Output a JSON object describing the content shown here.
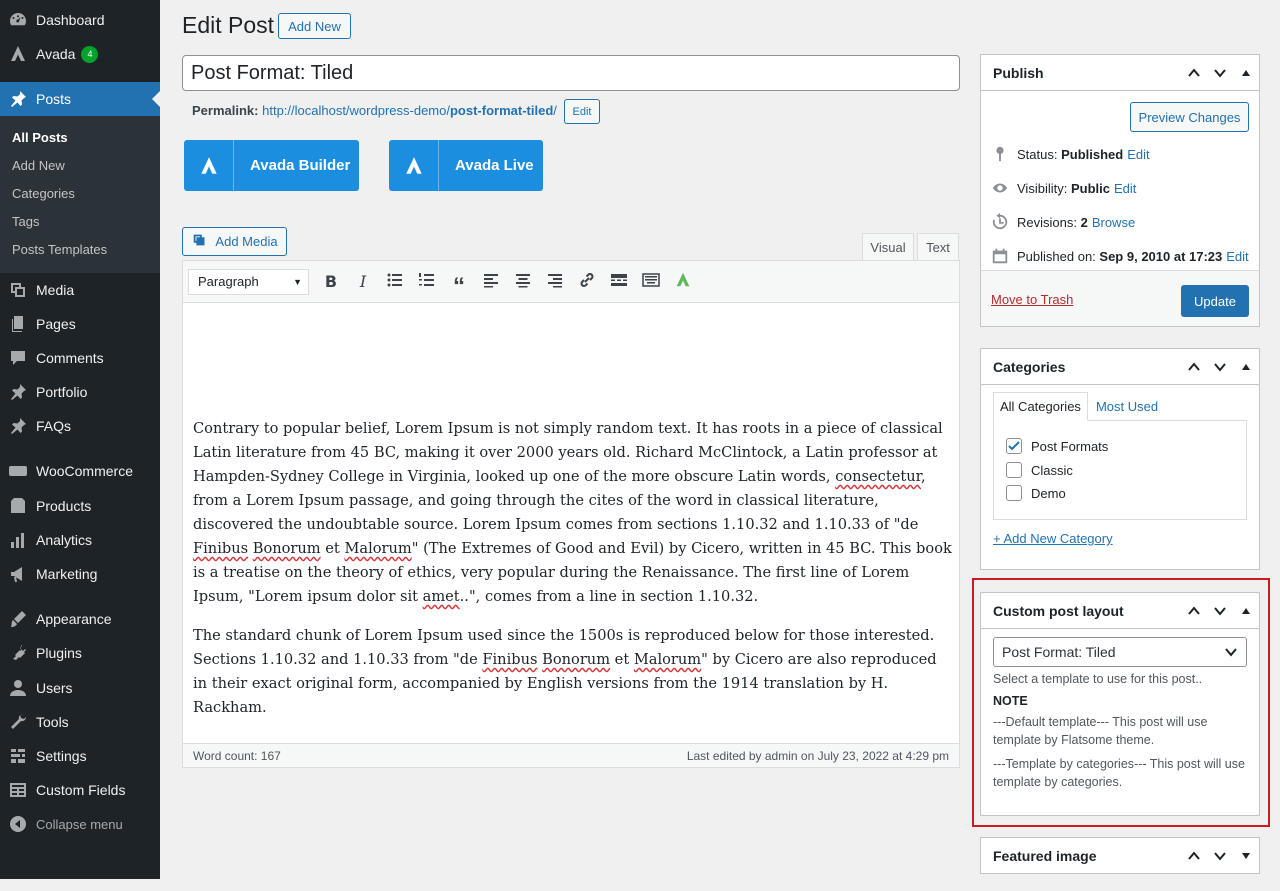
{
  "sidebar": {
    "items": [
      {
        "label": "Dashboard",
        "icon": "dashboard-icon"
      },
      {
        "label": "Avada",
        "icon": "avada-icon",
        "badge": "4"
      },
      {
        "label": "Posts",
        "icon": "pin-icon"
      },
      {
        "label": "Media",
        "icon": "media-icon"
      },
      {
        "label": "Pages",
        "icon": "pages-icon"
      },
      {
        "label": "Comments",
        "icon": "comments-icon"
      },
      {
        "label": "Portfolio",
        "icon": "pin-icon"
      },
      {
        "label": "FAQs",
        "icon": "pin-icon"
      },
      {
        "label": "WooCommerce",
        "icon": "woo-icon"
      },
      {
        "label": "Products",
        "icon": "products-icon"
      },
      {
        "label": "Analytics",
        "icon": "analytics-icon"
      },
      {
        "label": "Marketing",
        "icon": "megaphone-icon"
      },
      {
        "label": "Appearance",
        "icon": "brush-icon"
      },
      {
        "label": "Plugins",
        "icon": "plugin-icon"
      },
      {
        "label": "Users",
        "icon": "users-icon"
      },
      {
        "label": "Tools",
        "icon": "wrench-icon"
      },
      {
        "label": "Settings",
        "icon": "settings-icon"
      },
      {
        "label": "Custom Fields",
        "icon": "custom-fields-icon"
      }
    ],
    "submenu": [
      "All Posts",
      "Add New",
      "Categories",
      "Tags",
      "Posts Templates"
    ],
    "collapse": "Collapse menu"
  },
  "header": {
    "title": "Edit Post",
    "add_new": "Add New"
  },
  "post": {
    "title": "Post Format: Tiled",
    "permalink_label": "Permalink:",
    "permalink_base": "http://localhost/wordpress-demo/",
    "permalink_slug": "post-format-tiled",
    "permalink_end": "/",
    "edit": "Edit"
  },
  "avada": {
    "builder": "Avada Builder",
    "live": "Avada Live"
  },
  "editor": {
    "add_media": "Add Media",
    "tab_visual": "Visual",
    "tab_text": "Text",
    "format": "Paragraph",
    "word_count": "Word count: 167",
    "last_edited": "Last edited by admin on July 23, 2022 at 4:29 pm",
    "p1": [
      "Contrary to popular belief, Lorem Ipsum is not simply random text. It has roots in a piece of classical Latin literature from 45 BC, making it over 2000 years old. Richard McClintock, a Latin professor at Hampden-Sydney College in Virginia, looked up one of the more obscure Latin words, ",
      "consectetur",
      ", from a Lorem Ipsum passage, and going through the cites of the word in classical literature, discovered the undoubtable source. Lorem Ipsum comes from sections 1.10.32 and 1.10.33 of \"de ",
      "Finibus",
      " ",
      "Bonorum",
      " et ",
      "Malorum",
      "\" (The Extremes of Good and Evil) by Cicero, written in 45 BC. This book is a treatise on the theory of ethics, very popular during the Renaissance. The first line of Lorem Ipsum, \"Lorem ipsum dolor sit ",
      "amet",
      "..\", comes from a line in section 1.10.32."
    ],
    "p2": [
      "The standard chunk of Lorem Ipsum used since the 1500s is reproduced below for those interested. Sections 1.10.32 and 1.10.33 from \"de ",
      "Finibus",
      " ",
      "Bonorum",
      " et ",
      "Malorum",
      "\" by Cicero are also reproduced in their exact original form, accompanied by English versions from the 1914 translation by H. Rackham."
    ]
  },
  "publish": {
    "title": "Publish",
    "preview": "Preview Changes",
    "status_label": "Status:",
    "status_value": "Published",
    "visibility_label": "Visibility:",
    "visibility_value": "Public",
    "revisions_label": "Revisions:",
    "revisions_value": "2",
    "browse": "Browse",
    "published_label": "Published on:",
    "published_value": "Sep 9, 2010 at 17:23",
    "edit": "Edit",
    "trash": "Move to Trash",
    "update": "Update"
  },
  "categories": {
    "title": "Categories",
    "tab_all": "All Categories",
    "tab_used": "Most Used",
    "items": [
      {
        "label": "Post Formats",
        "checked": true
      },
      {
        "label": "Classic",
        "checked": false
      },
      {
        "label": "Demo",
        "checked": false
      }
    ],
    "add_new": "+ Add New Category"
  },
  "custom_layout": {
    "title": "Custom post layout",
    "selected": "Post Format: Tiled",
    "hint": "Select a template to use for this post..",
    "note_title": "NOTE",
    "note1": "---Default template--- This post will use template by Flatsome theme.",
    "note2": "---Template by categories--- This post will use template by categories."
  },
  "featured": {
    "title": "Featured image"
  },
  "colors": {
    "accent": "#2271b1",
    "sidebar": "#1d2327",
    "avada": "#1b8ee0",
    "highlight": "#d0191f"
  }
}
